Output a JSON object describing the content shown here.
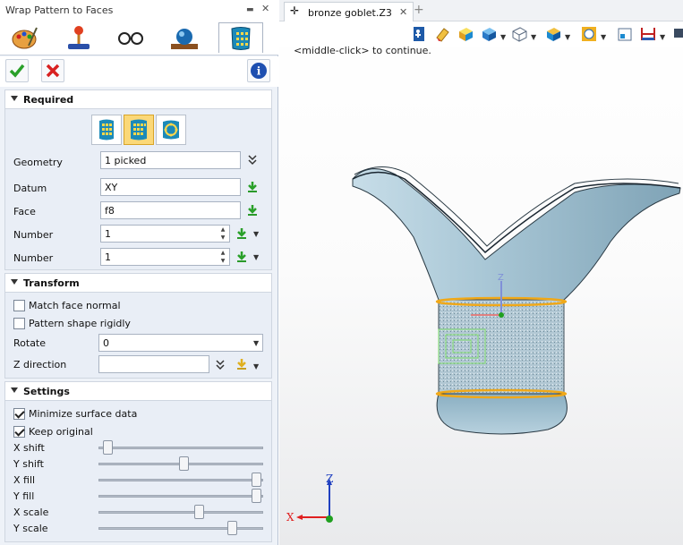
{
  "panel": {
    "title": "Wrap Pattern to Faces",
    "ribbon_tabs": [
      "appearance-tab",
      "tools-tab",
      "view-tab",
      "render-tab",
      "wrap-pattern-tab"
    ],
    "sections": {
      "required": "Required",
      "transform": "Transform",
      "settings": "Settings"
    }
  },
  "required": {
    "geometry_label": "Geometry",
    "geometry_value": "1 picked",
    "datum_label": "Datum",
    "datum_value": "XY",
    "face_label": "Face",
    "face_value": "f8",
    "number1_label": "Number",
    "number1_value": "1",
    "number2_label": "Number",
    "number2_value": "1"
  },
  "transform": {
    "match_face_normal": "Match face normal",
    "match_face_normal_checked": false,
    "pattern_rigid": "Pattern shape rigidly",
    "pattern_rigid_checked": false,
    "rotate_label": "Rotate",
    "rotate_value": "0",
    "zdir_label": "Z direction",
    "zdir_value": ""
  },
  "settings": {
    "minimize": "Minimize surface data",
    "minimize_checked": true,
    "keep": "Keep original",
    "keep_checked": true,
    "sliders": [
      {
        "label": "X shift",
        "value": 0.03
      },
      {
        "label": "Y shift",
        "value": 0.52
      },
      {
        "label": "X fill",
        "value": 0.99
      },
      {
        "label": "Y fill",
        "value": 0.99
      },
      {
        "label": "X scale",
        "value": 0.62
      },
      {
        "label": "Y scale",
        "value": 0.83
      }
    ]
  },
  "viewport": {
    "tab_name": "bronze goblet.Z3",
    "message": "<middle-click> to continue.",
    "axis_x": "X",
    "axis_z": "Z",
    "gizmo_z": "Z",
    "colors": {
      "goblet": "#a9c7d6",
      "band": "#f0a818",
      "pattern": "#7fdc6a",
      "axis_x": "#e02020",
      "axis_z": "#2040c0"
    }
  }
}
